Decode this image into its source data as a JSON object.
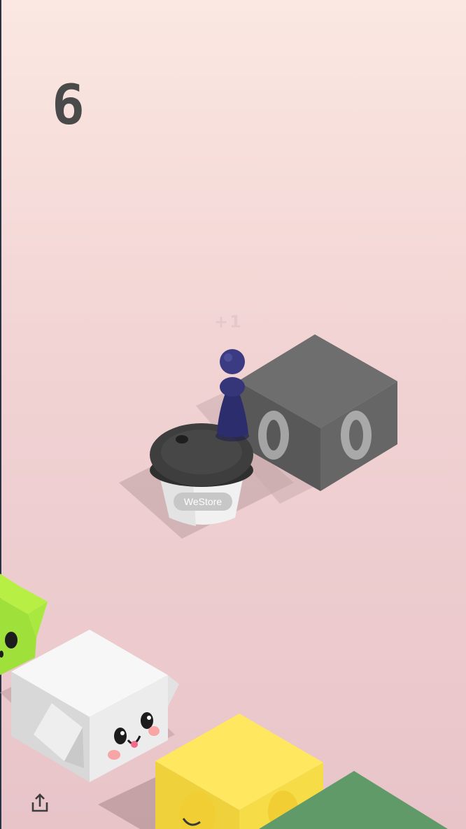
{
  "game": {
    "score": "6",
    "bonus_popup": "+1",
    "cup_brand": "WeStore"
  },
  "controls": {
    "share_icon": "share-icon"
  },
  "colors": {
    "player": "#2f3070",
    "speaker_box": "#5f5f5f",
    "cup_lid": "#3f3f3f",
    "green_cube": "#9fe13a",
    "white_cube": "#f3f3f3",
    "yellow_cube": "#f6e05a",
    "green_plane": "#5f9a68"
  }
}
